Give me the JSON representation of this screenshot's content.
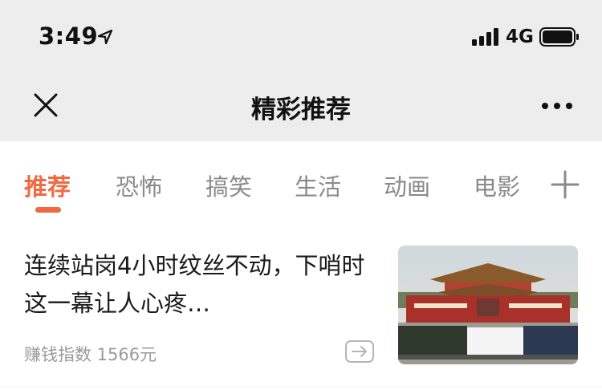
{
  "status_bar": {
    "time": "3:49",
    "network": "4G"
  },
  "nav": {
    "title": "精彩推荐"
  },
  "tabs": [
    {
      "label": "推荐",
      "active": true
    },
    {
      "label": "恐怖",
      "active": false
    },
    {
      "label": "搞笑",
      "active": false
    },
    {
      "label": "生活",
      "active": false
    },
    {
      "label": "动画",
      "active": false
    },
    {
      "label": "电影",
      "active": false
    }
  ],
  "article": {
    "title": "连续站岗4小时纹丝不动，下哨时这一幕让人心疼…",
    "meta": "赚钱指数 1566元",
    "image_alt": "tiananmen-parade"
  },
  "colors": {
    "accent": "#ef6a42",
    "top_bg": "#ededed"
  },
  "icons": [
    "location-arrow-icon",
    "signal-icon",
    "battery-icon",
    "close-icon",
    "more-icon",
    "add-icon",
    "share-arrow-icon"
  ]
}
